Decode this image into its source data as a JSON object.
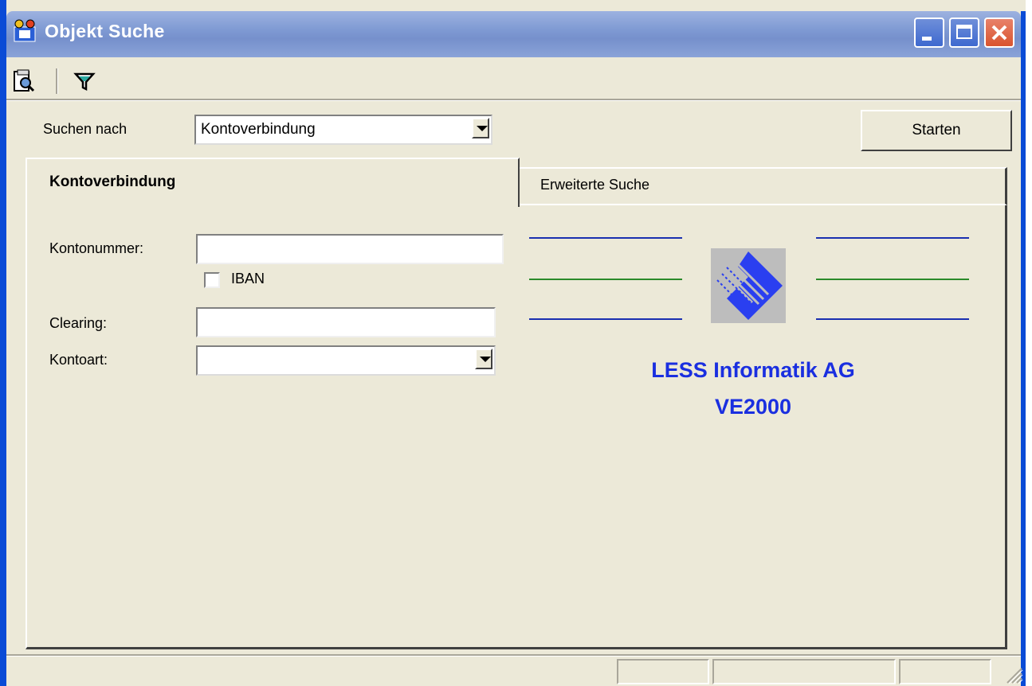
{
  "window": {
    "title": "Objekt Suche",
    "icon": "objekt-suche-app-icon",
    "controls": {
      "minimize": "minimize-icon",
      "maximize": "maximize-icon",
      "close": "close-icon"
    }
  },
  "toolbar": {
    "items": [
      {
        "icon": "search-document-icon"
      },
      {
        "icon": "filter-icon"
      }
    ]
  },
  "search": {
    "label": "Suchen nach",
    "selected": "Kontoverbindung",
    "start_label": "Starten"
  },
  "tabs": [
    {
      "label": "Kontoverbindung",
      "active": true
    },
    {
      "label": "Erweiterte Suche",
      "active": false
    }
  ],
  "form": {
    "kontonummer_label": "Kontonummer:",
    "kontonummer_value": "",
    "iban_label": "IBAN",
    "iban_checked": false,
    "clearing_label": "Clearing:",
    "clearing_value": "",
    "kontoart_label": "Kontoart:",
    "kontoart_value": ""
  },
  "branding": {
    "company": "LESS Informatik AG",
    "product": "VE2000",
    "text_color": "#1a2fe0",
    "line_colors": [
      "#1a2fb0",
      "#2a8a2a",
      "#1a2fb0"
    ]
  },
  "colors": {
    "title_bar": "#7f9ad3",
    "window_bg": "#ece9d8",
    "close_button": "#d9542f"
  }
}
